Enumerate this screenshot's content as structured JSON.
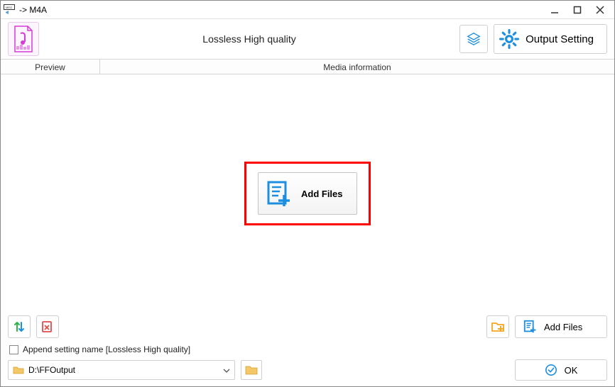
{
  "titlebar": {
    "title": " -> M4A"
  },
  "toolbar": {
    "quality_label": "Lossless High quality",
    "output_setting_label": "Output Setting"
  },
  "columns": {
    "preview": "Preview",
    "media_info": "Media information"
  },
  "main": {
    "add_files_label": "Add Files"
  },
  "bottom": {
    "add_files_label": "Add Files",
    "append_label": "Append setting name [Lossless High quality]",
    "output_path": "D:\\FFOutput",
    "ok_label": "OK"
  },
  "colors": {
    "accent_blue": "#1e8fe0",
    "accent_orange": "#f5a623",
    "accent_red": "#e34b4b",
    "accent_green": "#2fb24c",
    "accent_magenta": "#d63ad6"
  }
}
